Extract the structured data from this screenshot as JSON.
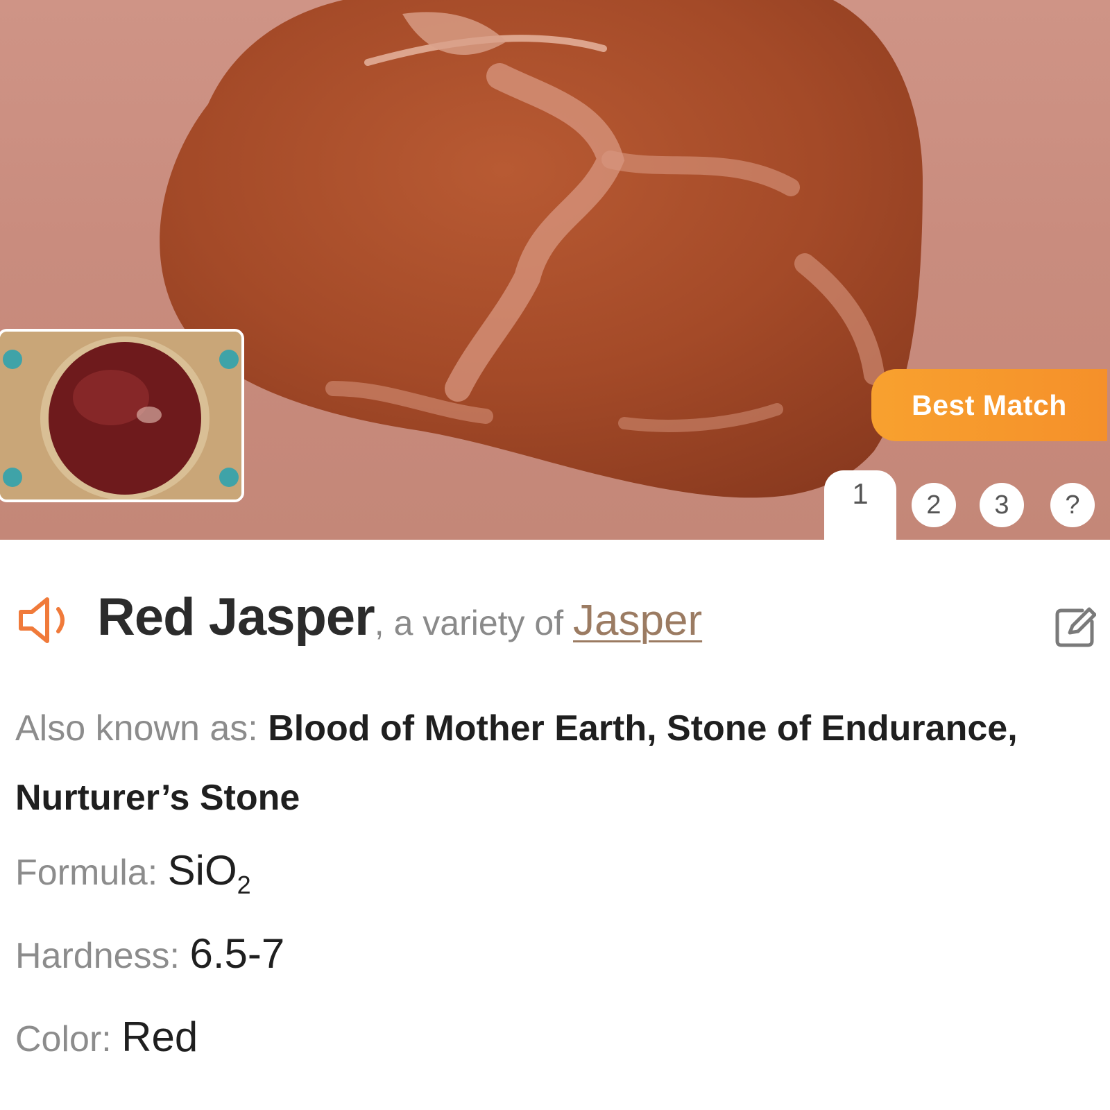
{
  "hero": {
    "badge_label": "Best Match",
    "tabs": [
      "1",
      "2",
      "3",
      "?"
    ],
    "active_tab": "1"
  },
  "result": {
    "name": "Red Jasper",
    "comma": ",",
    "variety_prefix": " a variety of ",
    "parent_link": "Jasper"
  },
  "details": {
    "aka_label": "Also known as: ",
    "aka_value": "Blood of Mother Earth, Stone of Endurance, Nurturer’s Stone",
    "formula_label": "Formula: ",
    "formula_main": "SiO",
    "formula_sub": "2",
    "hardness_label": "Hardness: ",
    "hardness_value": "6.5-7",
    "color_label": "Color: ",
    "color_value": "Red"
  },
  "colors": {
    "accent": "#f5902a",
    "link": "#9b7b62",
    "speaker_icon": "#f07a3a"
  },
  "icons": {
    "speaker": "speaker-icon",
    "edit": "edit-icon"
  }
}
